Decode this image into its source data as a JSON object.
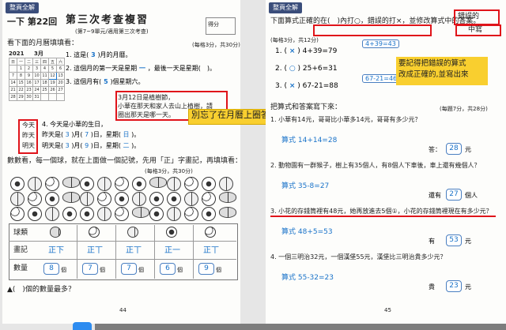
{
  "left_page": {
    "tag": "整頁全解",
    "unit": "一下 第22回",
    "title": "第三次考查複習",
    "subtitle": "(第7~9單元/適用第三次考查)",
    "score_label": "得分",
    "q1_instruction": "看下面的月曆填填看：",
    "q1_points": "(每格3分，共30分)",
    "calendar_year": "2021",
    "calendar_month": "3月",
    "calendar_header": [
      "日",
      "一",
      "二",
      "三",
      "四",
      "五",
      "六"
    ],
    "calendar_rows": [
      [
        "",
        "1",
        "2",
        "3",
        "4",
        "5",
        "6"
      ],
      [
        "7",
        "8",
        "9",
        "10",
        "11",
        "12",
        "13"
      ],
      [
        "14",
        "15",
        "16",
        "17",
        "18",
        "19",
        "20"
      ],
      [
        "21",
        "22",
        "23",
        "24",
        "25",
        "26",
        "27"
      ],
      [
        "28",
        "29",
        "30",
        "31",
        "",
        "",
        ""
      ]
    ],
    "q1_lines": [
      {
        "pre": "1. 這是(",
        "ans": "3",
        "post": ")月的月曆。"
      },
      {
        "pre": "2. 這個月的第一天是星期",
        "ans": "一",
        "post": "，最後一天是星期(　)。"
      },
      {
        "pre": "3. 這個月有(",
        "ans": "5",
        "post": ")個星期六。"
      }
    ],
    "boxed_text": [
      "3月12日是植樹節，",
      "小華在那天和家人去山上植樹，請",
      "圈出那天是哪一天。"
    ],
    "q4_labels": [
      "今天",
      "昨天",
      "明天"
    ],
    "q4_lines": [
      {
        "pre": "4. 今天是小華的生日，",
        "post": ""
      },
      {
        "pre": "昨天是(",
        "ans1": "3",
        "mid": ")月(",
        "ans2": "7",
        "post2": ")日，星期(",
        "ans3": "日",
        "end": ")。"
      },
      {
        "pre": "明天是(",
        "ans1": "3",
        "mid": ")月(",
        "ans2": "9",
        "post2": ")日，星期(",
        "ans3": "二",
        "end": ")。"
      }
    ],
    "q2_instruction": "數數看，每一個球，就在上面做一個記號，先用「正」字畫記，再填填看：",
    "q2_points": "(每格3分，共30分)",
    "tally_row_labels": [
      "球類",
      "畫記",
      "數量"
    ],
    "tally_marks": [
      "正下",
      "正丅",
      "正丅",
      "正一",
      "正丅"
    ],
    "tally_counts": [
      "8",
      "7",
      "7",
      "6",
      "9"
    ],
    "tally_unit": "個",
    "bottom_question": "▲(　)個的數量最多？",
    "page_number": "44",
    "red_note": "別忘了在月曆上圈答案"
  },
  "right_page": {
    "tag": "整頁全解",
    "q3_instruction": "下面算式正確的在(　)內打○，錯誤的打×，並修改算式中的答案。",
    "q3_points": "(每格3分，共12分)",
    "wrong_label": "錯誤的",
    "middle_label": "中寫",
    "q3_items": [
      {
        "mark": "×",
        "expr": "4+39=79",
        "fix": "4+39=43"
      },
      {
        "mark": "○",
        "expr": "25+6=31",
        "fix": ""
      },
      {
        "mark": "×",
        "expr": "67-21=88",
        "fix": "67-21=46"
      }
    ],
    "yellow_note_lines": [
      "要記得把錯誤的算式",
      "改成正確的,並寫出來"
    ],
    "q4_instruction": "把算式和答案寫下來：",
    "q4_points": "(每題7分，共28分)",
    "problems": [
      {
        "text": "1. 小華有14元，哥哥比小華多14元，哥哥有多少元？",
        "formula": "算式 14+14=28",
        "answer_pre": "答：",
        "answer": "28",
        "unit": "元"
      },
      {
        "text": "2. 動物園有一群猴子，樹上有35個人，有8個人下車後，車上還有幾個人？",
        "formula": "算式 35-8=27",
        "answer_pre": "還有",
        "answer": "27",
        "unit": "個人"
      },
      {
        "text": "3. 小花的存錢筒裡有48元，她再放進去5個①，小花的存錢筒裡現在有多少元？",
        "formula": "算式 48+5=53",
        "answer_pre": "有",
        "answer": "53",
        "unit": "元"
      },
      {
        "text": "4. 一個三明治32元，一個漢堡55元，漢堡比三明治貴多少元？",
        "formula": "算式 55-32=23",
        "answer_pre": "貴",
        "answer": "23",
        "unit": "元"
      }
    ],
    "page_number": "45"
  }
}
